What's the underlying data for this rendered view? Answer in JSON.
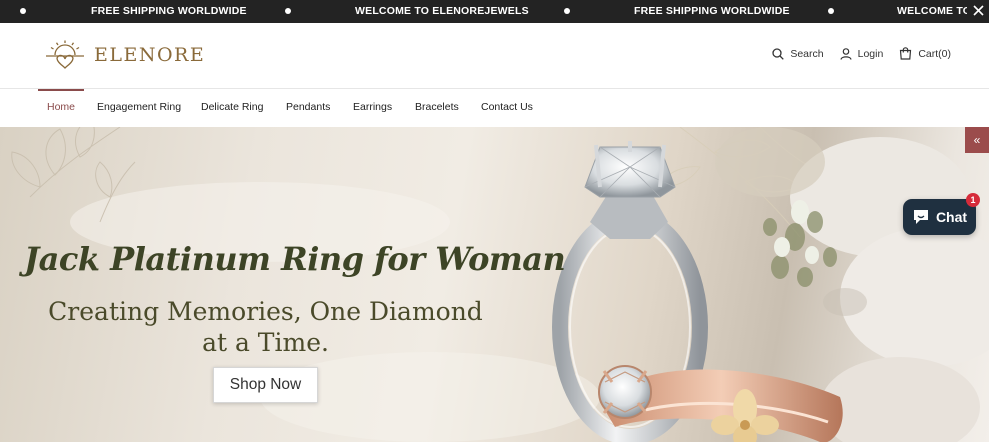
{
  "announcement": {
    "items": [
      "FREE SHIPPING WORLDWIDE",
      "WELCOME TO ELENOREJEWELS",
      "FREE SHIPPING WORLDWIDE",
      "WELCOME TO"
    ],
    "close_icon": "close-icon"
  },
  "header": {
    "brand": "ELENORE",
    "search_label": "Search",
    "login_label": "Login",
    "cart_label": "Cart(0)"
  },
  "nav": {
    "items": [
      "Home",
      "Engagement Ring",
      "Delicate Ring",
      "Pendants",
      "Earrings",
      "Bracelets",
      "Contact Us"
    ],
    "active": "Home"
  },
  "hero": {
    "title": "Jack Platinum Ring for Woman",
    "subtitle_line1": "Creating Memories, One Diamond",
    "subtitle_line2": "at a Time.",
    "cta": "Shop Now",
    "side_tab": "«"
  },
  "chat": {
    "label": "Chat",
    "badge": "1"
  },
  "colors": {
    "announcement_bg": "#232323",
    "brand_gold": "#8a6a3a",
    "accent": "#8a4b4b",
    "hero_text": "#3d4426",
    "chat_bg": "#1f3040",
    "badge_red": "#d62b3a"
  }
}
